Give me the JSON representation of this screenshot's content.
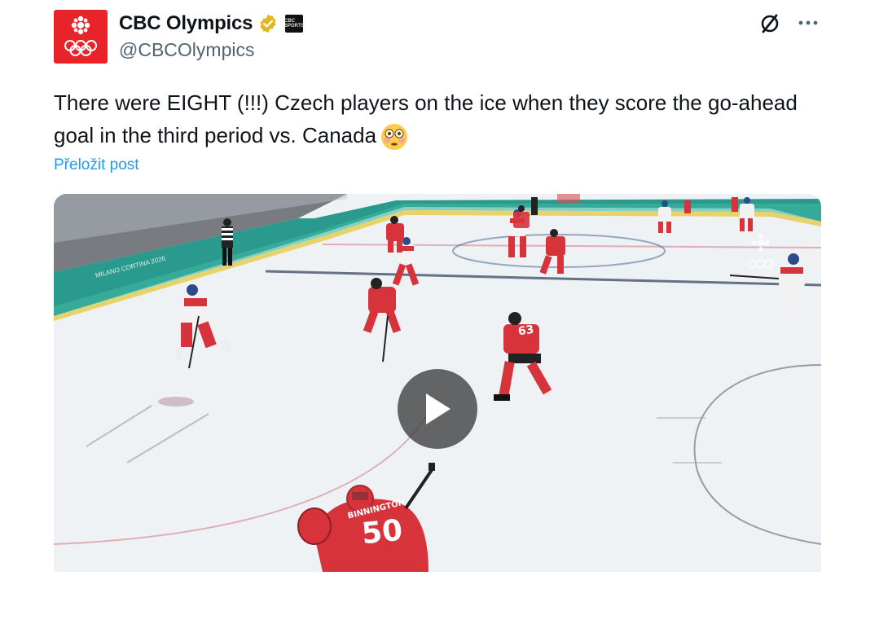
{
  "author": {
    "display_name": "CBC Olympics",
    "handle": "@CBCOlympics",
    "verified": true,
    "avatar_icon": "cbc-olympic-rings-logo",
    "affiliate_badge_text": "CBC SPORTS"
  },
  "header_icons": {
    "grok": "grok-icon",
    "more": "more-icon"
  },
  "tweet": {
    "text": "There were EIGHT (!!!) Czech players on the ice when they score the go-ahead goal in the third period vs. Canada",
    "emoji": "flushed-face-emoji",
    "translate_label": "Přeložit post"
  },
  "media": {
    "type": "video",
    "play_icon": "play-icon",
    "board_text": "MILANO CORTINA 2026",
    "goalie_name": "BINNINGTON",
    "goalie_number": "50",
    "player_number": "63"
  },
  "colors": {
    "accent": "#1d9bf0",
    "avatar_red": "#e8232a",
    "verified_gold": "#e2b719",
    "secondary_text": "#536471"
  }
}
